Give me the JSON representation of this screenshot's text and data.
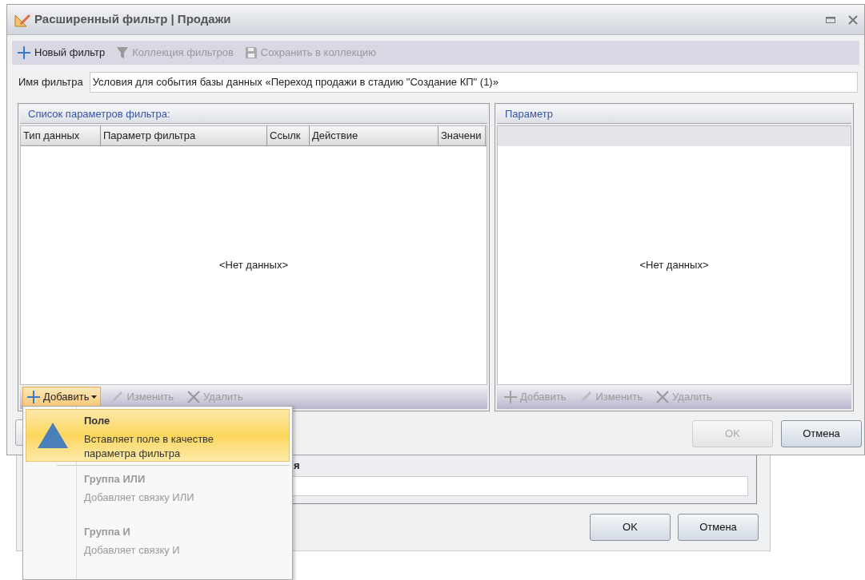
{
  "window": {
    "title": "Расширенный фильтр | Продажи"
  },
  "toolbar": [
    {
      "label": "Новый фильтр",
      "kind": "plus",
      "disabled": false
    },
    {
      "label": "Коллекция фильтров",
      "kind": "funnel",
      "disabled": true
    },
    {
      "label": "Сохранить в коллекцию",
      "kind": "save",
      "disabled": true
    }
  ],
  "filter_name": {
    "label": "Имя фильтра",
    "value": "Условия для события базы данных «Переход продажи в стадию \"Создание КП\" (1)»"
  },
  "params_list": {
    "title": "Список параметров фильтра:",
    "empty_text": "<Нет данных>",
    "columns": [
      "Тип данных",
      "Параметр фильтра",
      "Ссылк",
      "Действие",
      "Значени"
    ],
    "actions": [
      {
        "label": "Добавить",
        "kind": "add",
        "disabled": false,
        "dropdown": true,
        "pressed": true
      },
      {
        "label": "Изменить",
        "kind": "edit",
        "disabled": true,
        "dropdown": false,
        "pressed": false
      },
      {
        "label": "Удалить",
        "kind": "delete",
        "disabled": true,
        "dropdown": false,
        "pressed": false
      }
    ]
  },
  "parameter_panel": {
    "title": "Параметр",
    "empty_text": "<Нет данных>",
    "actions": [
      {
        "label": "Добавить",
        "kind": "add",
        "disabled": true,
        "dropdown": false,
        "pressed": false
      },
      {
        "label": "Изменить",
        "kind": "edit",
        "disabled": true,
        "dropdown": false,
        "pressed": false
      },
      {
        "label": "Удалить",
        "kind": "delete",
        "disabled": true,
        "dropdown": false,
        "pressed": false
      }
    ]
  },
  "buttons": [
    {
      "label": "OK",
      "disabled": true
    },
    {
      "label": "Отмена",
      "disabled": false
    }
  ],
  "add_menu": {
    "items": [
      {
        "kind": "field",
        "title": "Поле",
        "description": "Вставляет поле в качестве параметра фильтра",
        "selected": true,
        "disabled": false
      },
      {
        "kind": "group",
        "title": "Группа ИЛИ",
        "description": "Добавляет связку ИЛИ",
        "selected": false,
        "disabled": true
      },
      {
        "kind": "group",
        "title": "Группа И",
        "description": "Добавляет связку И",
        "selected": false,
        "disabled": true
      }
    ]
  },
  "background_dialog": {
    "label": "я",
    "buttons": [
      {
        "label": "OK",
        "disabled": false
      },
      {
        "label": "Отмена",
        "disabled": false
      }
    ]
  }
}
